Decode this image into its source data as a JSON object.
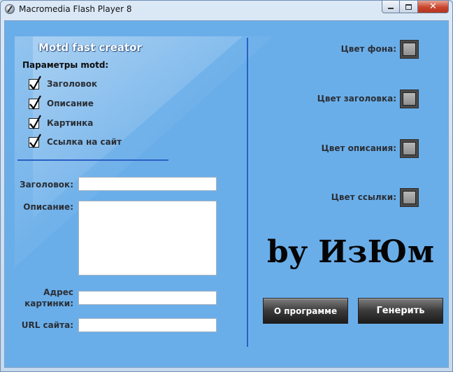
{
  "window": {
    "title": "Macromedia Flash Player 8",
    "controls": {
      "minimize": "minimize-icon",
      "maximize": "maximize-icon",
      "close": "✕"
    }
  },
  "app": {
    "title": "Motd fast creator",
    "params_heading": "Параметры motd:",
    "checkboxes": [
      {
        "label": "Заголовок",
        "checked": true
      },
      {
        "label": "Описание",
        "checked": true
      },
      {
        "label": "Картинка",
        "checked": true
      },
      {
        "label": "Ссылка на сайт",
        "checked": true
      }
    ],
    "fields": {
      "title_label": "Заголовок:",
      "title_value": "",
      "description_label": "Описание:",
      "description_value": "",
      "image_label": "Адрес картинки:",
      "image_value": "",
      "url_label": "URL сайта:",
      "url_value": ""
    },
    "colors": [
      {
        "label": "Цвет фона:"
      },
      {
        "label": "Цвет заголовка:"
      },
      {
        "label": "Цвет описания:"
      },
      {
        "label": "Цвет ссылки:"
      }
    ],
    "byline": "by ИзЮм",
    "buttons": {
      "about": "О программе",
      "generate": "Генерить"
    }
  },
  "colors": {
    "stage_bg": "#6aaee9",
    "divider": "#2b5fc4",
    "button_dark": "#2e2e2e"
  }
}
